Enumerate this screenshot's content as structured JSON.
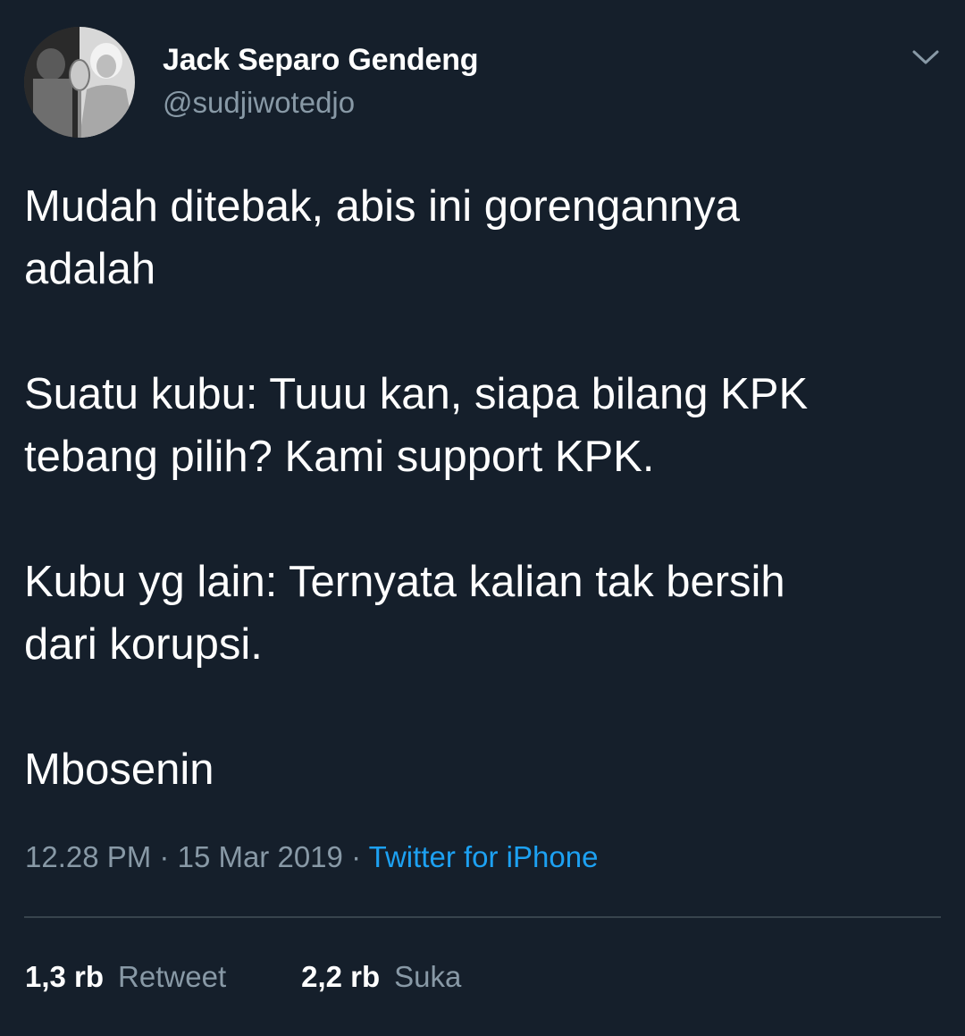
{
  "tweet": {
    "author": {
      "name": "Jack Separo Gendeng",
      "handle": "@sudjiwotedjo"
    },
    "menu_icon": "chevron-down-icon",
    "paragraphs": [
      [
        "Mudah ditebak, abis ini gorengannya",
        "adalah"
      ],
      [
        "Suatu kubu: Tuuu kan, siapa bilang KPK",
        "tebang pilih? Kami support KPK."
      ],
      [
        "Kubu yg lain: Ternyata kalian tak bersih",
        "dari korupsi."
      ],
      [
        "Mbosenin"
      ]
    ],
    "time": "12.28 PM",
    "date": "15 Mar 2019",
    "separator": "·",
    "source": "Twitter for iPhone",
    "stats": {
      "retweets": {
        "count": "1,3 rb",
        "label": "Retweet"
      },
      "likes": {
        "count": "2,2 rb",
        "label": "Suka"
      }
    }
  },
  "colors": {
    "background": "#151f2b",
    "primary_text": "#ffffff",
    "secondary_text": "#8899a6",
    "link": "#1da1f2",
    "divider": "#38444d"
  }
}
